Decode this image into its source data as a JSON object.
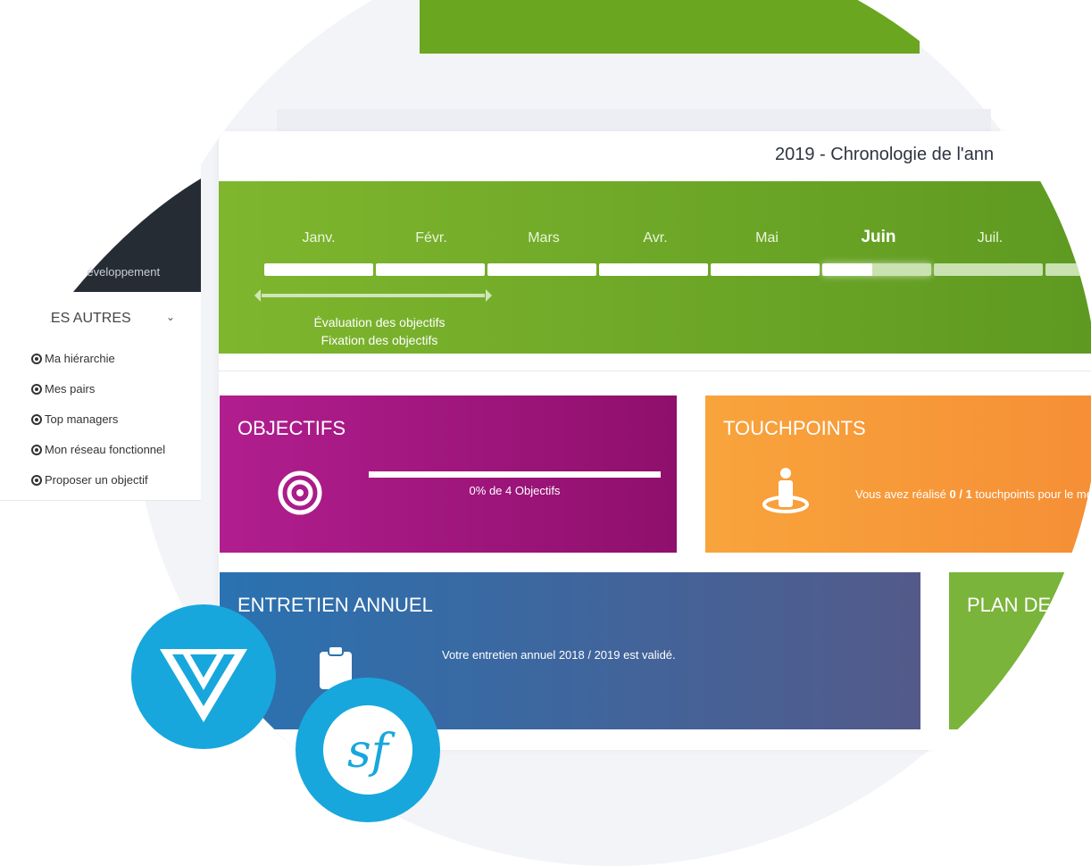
{
  "header": {
    "title": "2019 - Chronologie de l'ann"
  },
  "timeline": {
    "months": [
      "Janv.",
      "Févr.",
      "Mars",
      "Avr.",
      "Mai",
      "Juin",
      "Juil."
    ],
    "current_month": "Juin",
    "notes": [
      "Évaluation des objectifs",
      "Fixation des objectifs"
    ],
    "color": "#6fa826"
  },
  "sidebar": {
    "dev_label": "Développement",
    "section": "LES AUTRES",
    "items": [
      "Ma hiérarchie",
      "Mes pairs",
      "Top managers",
      "Mon réseau fonctionnel",
      "Proposer un objectif"
    ]
  },
  "cards": {
    "objectifs": {
      "title": "OBJECTIFS",
      "progress_text": "0% de 4 Objectifs",
      "progress": 0,
      "color": "#a0177e"
    },
    "touchpoints": {
      "title": "TOUCHPOINTS",
      "text_pre": "Vous avez réalisé ",
      "text_bold": "0 / 1",
      "text_post": " touchpoints pour le mo",
      "color": "#f79a39"
    },
    "entretien": {
      "title": "ENTRETIEN ANNUEL",
      "text": "Votre entretien annuel 2018 / 2019 est validé.",
      "color": "#3d66a0"
    },
    "plan": {
      "title": "PLAN DE",
      "color": "#7ab43a"
    }
  },
  "badges": [
    "vue-logo",
    "symfony-logo"
  ]
}
